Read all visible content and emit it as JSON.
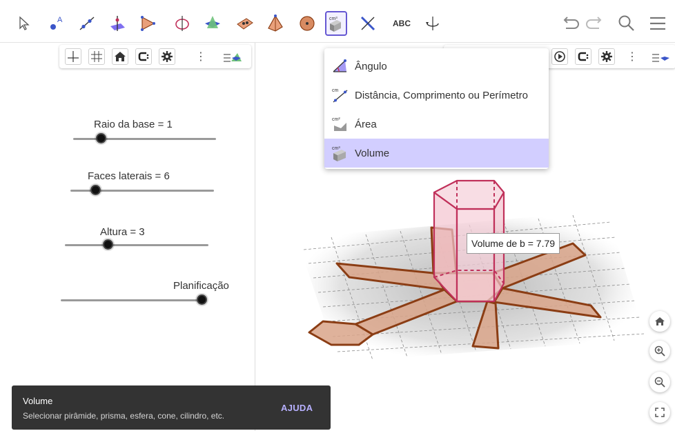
{
  "toolbar": {
    "tools": [
      "move-tool",
      "point-tool",
      "line-tool",
      "perpendicular-tool",
      "polygon-tool",
      "circle-tool",
      "intersect-surface-tool",
      "sphere-tool",
      "pyramid-tool",
      "sphere-point-tool",
      "measurement-tool",
      "reflect-tool",
      "text-tool",
      "rotate-view-tool"
    ],
    "text_tool_label": "ABC",
    "selected_tool": "measurement-tool"
  },
  "menu": {
    "items": [
      {
        "label": "Ângulo",
        "icon": "angle-icon"
      },
      {
        "label": "Distância, Comprimento ou Perímetro",
        "icon": "distance-icon"
      },
      {
        "label": "Área",
        "icon": "area-icon"
      },
      {
        "label": "Volume",
        "icon": "volume-icon"
      }
    ],
    "active_index": 3
  },
  "sliders": [
    {
      "label": "Raio da base = 1",
      "value": 0.2
    },
    {
      "label": "Faces laterais = 6",
      "value": 0.18
    },
    {
      "label": "Altura = 3",
      "value": 0.3
    },
    {
      "label": "Planificação",
      "value": 0.98
    }
  ],
  "graphics": {
    "volume_label": "Volume de b = 7.79"
  },
  "toast": {
    "title": "Volume",
    "description": "Selecionar pirâmide, prisma, esfera, cone, cilindro, etc.",
    "help_label": "AJUDA"
  },
  "colors": {
    "accent": "#6557d2",
    "menu_highlight": "#d2ceff",
    "net_fill": "#d9a48a",
    "net_stroke": "#8b3d14",
    "prism_stroke": "#c0305a",
    "prism_fill": "#f4c3cf",
    "toast_bg": "#333333",
    "help_text": "#b7b0ff"
  }
}
